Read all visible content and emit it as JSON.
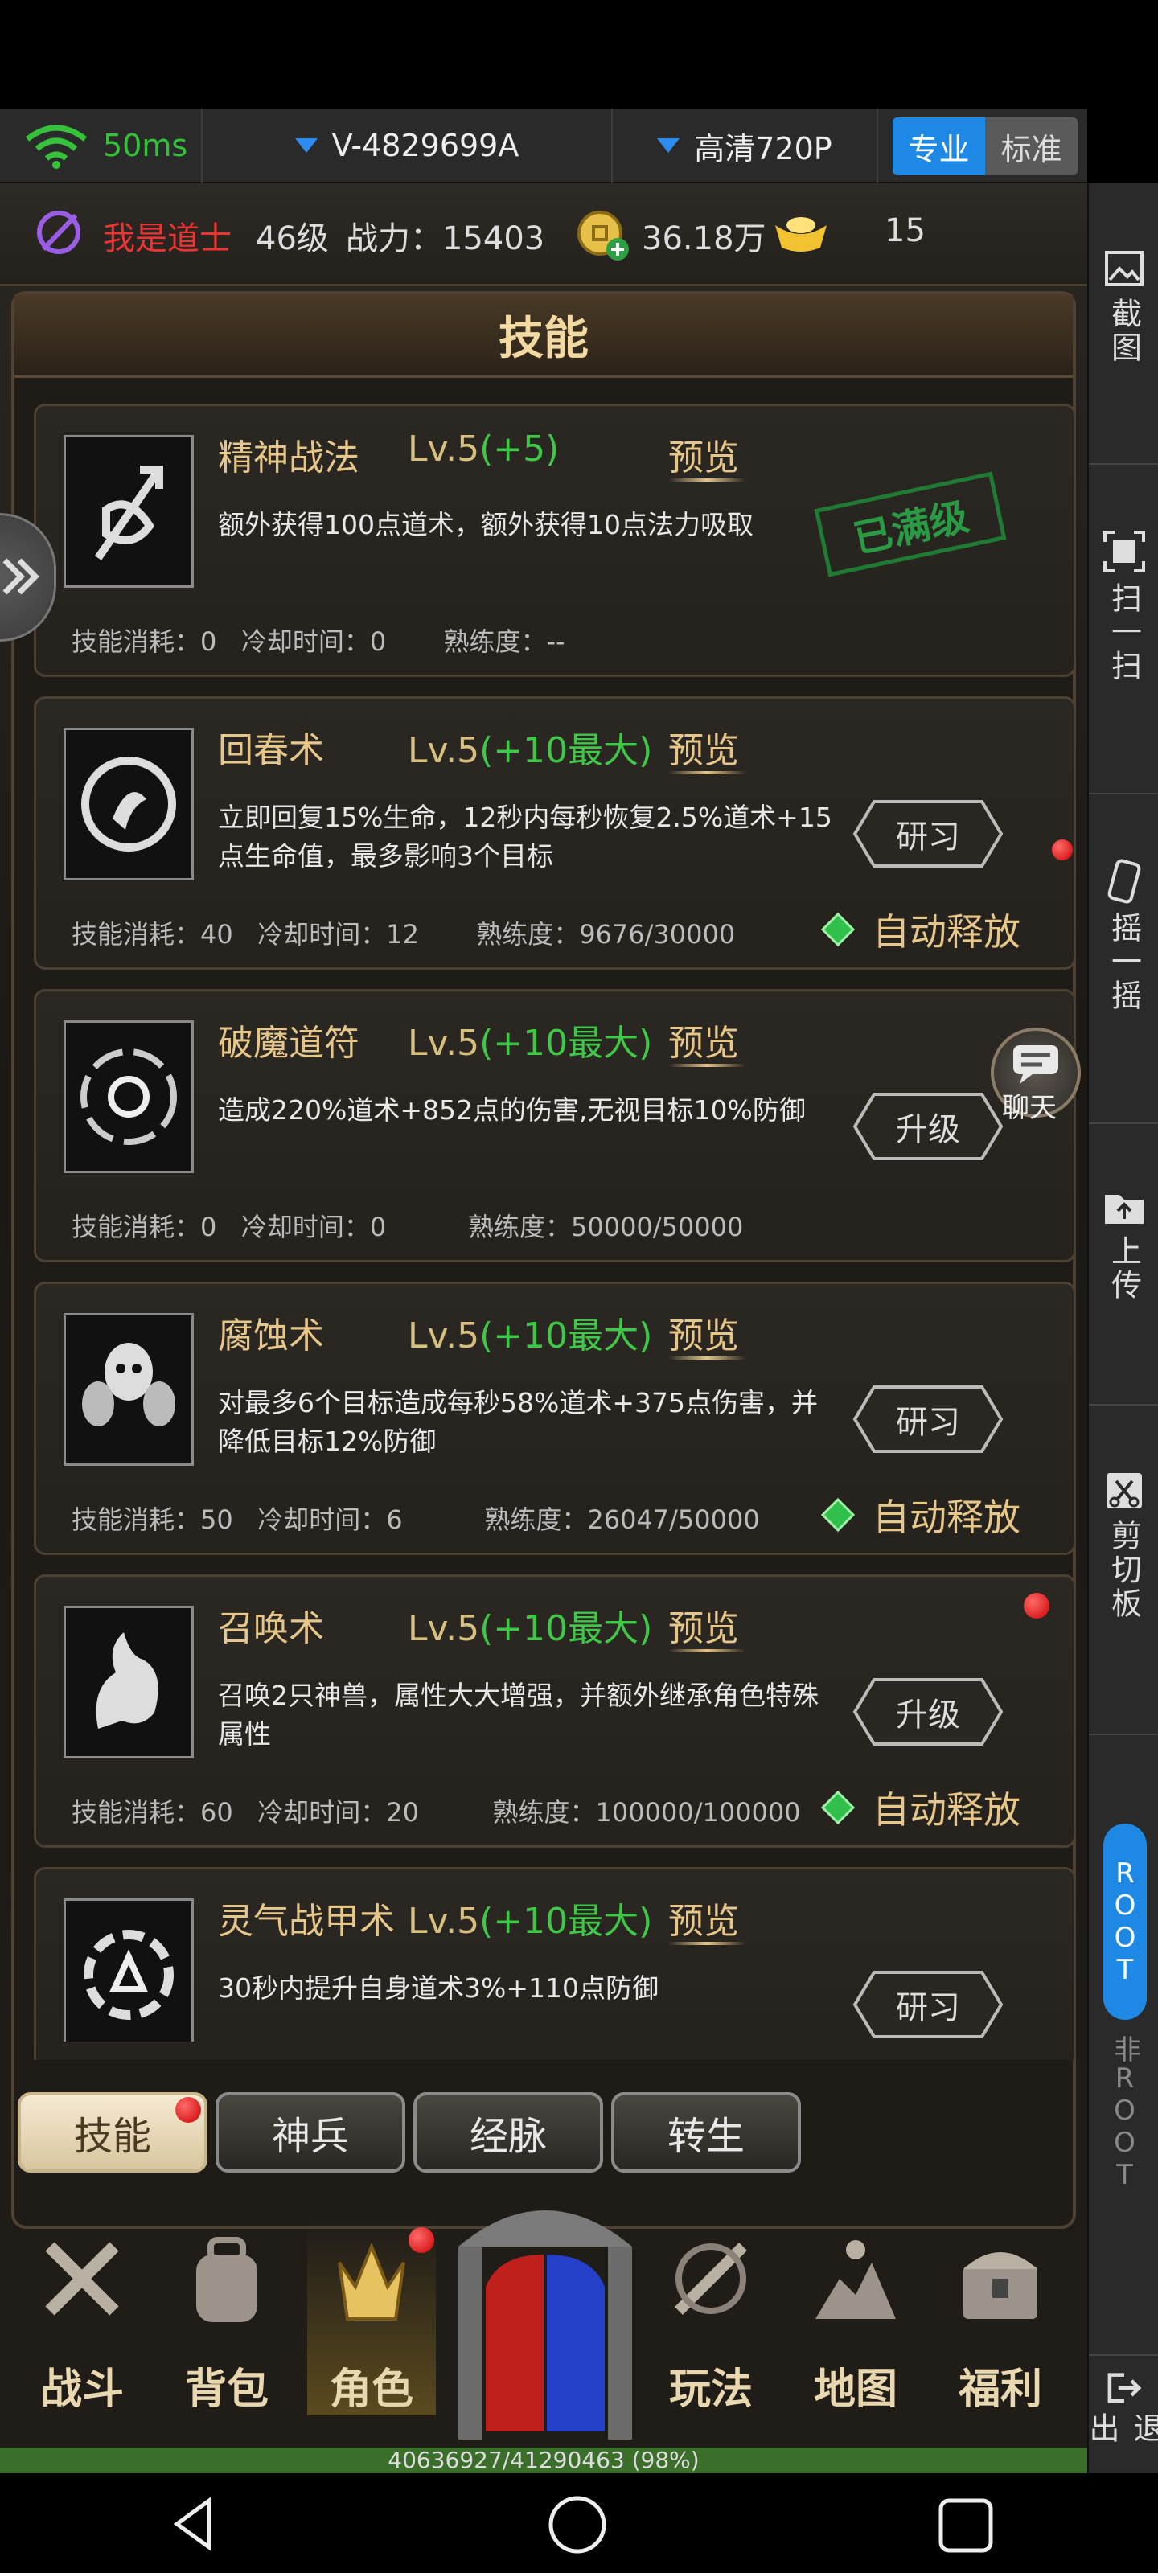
{
  "status": {
    "ping": "50ms",
    "device_id": "V-4829699A",
    "quality": "高清720P",
    "mode_pro": "专业",
    "mode_std": "标准"
  },
  "player": {
    "name": "我是道士",
    "level": "46级",
    "power": "战力：15403",
    "gold": "36.18万",
    "ingot": "15"
  },
  "panel_title": "技能",
  "skills": [
    {
      "name": "精神战法",
      "level": "Lv.5",
      "bonus": "(+5)",
      "preview": "预览",
      "desc": "额外获得100点道术，额外获得10点法力吸取",
      "cost": "技能消耗：0",
      "cooldown": "冷却时间：0",
      "proficiency": "熟练度：--",
      "badge": "已满级"
    },
    {
      "name": "回春术",
      "level": "Lv.5",
      "bonus": "(+10最大)",
      "preview": "预览",
      "desc": "立即回复15%生命，12秒内每秒恢复2.5%道术+15点生命值，最多影响3个目标",
      "cost": "技能消耗：40",
      "cooldown": "冷却时间：12",
      "proficiency": "熟练度：9676/30000",
      "button": "研习",
      "auto": "自动释放"
    },
    {
      "name": "破魔道符",
      "level": "Lv.5",
      "bonus": "(+10最大)",
      "preview": "预览",
      "desc": "造成220%道术+852点的伤害,无视目标10%防御",
      "cost": "技能消耗：0",
      "cooldown": "冷却时间：0",
      "proficiency": "熟练度：50000/50000",
      "button": "升级"
    },
    {
      "name": "腐蚀术",
      "level": "Lv.5",
      "bonus": "(+10最大)",
      "preview": "预览",
      "desc": "对最多6个目标造成每秒58%道术+375点伤害，并降低目标12%防御",
      "cost": "技能消耗：50",
      "cooldown": "冷却时间：6",
      "proficiency": "熟练度：26047/50000",
      "button": "研习",
      "auto": "自动释放"
    },
    {
      "name": "召唤术",
      "level": "Lv.5",
      "bonus": "(+10最大)",
      "preview": "预览",
      "desc": "召唤2只神兽，属性大大增强，并额外继承角色特殊属性",
      "cost": "技能消耗：60",
      "cooldown": "冷却时间：20",
      "proficiency": "熟练度：100000/100000",
      "button": "升级",
      "auto": "自动释放"
    },
    {
      "name": "灵气战甲术",
      "level": "Lv.5",
      "bonus": "(+10最大)",
      "preview": "预览",
      "desc": "30秒内提升自身道术3%+110点防御",
      "button": "研习"
    }
  ],
  "chat_label": "聊天",
  "subtabs": [
    "技能",
    "神兵",
    "经脉",
    "转生"
  ],
  "nav": [
    "战斗",
    "背包",
    "角色",
    "玩法",
    "地图",
    "福利"
  ],
  "hp_text": "40636927/41290463 (98%)",
  "side": {
    "screenshot": "截图",
    "scan": "扫一扫",
    "shake": "摇一摇",
    "upload": "上传",
    "clipboard": "剪切板",
    "root": "ROOT",
    "nonroot": "非ROOT",
    "exit": "退出"
  }
}
